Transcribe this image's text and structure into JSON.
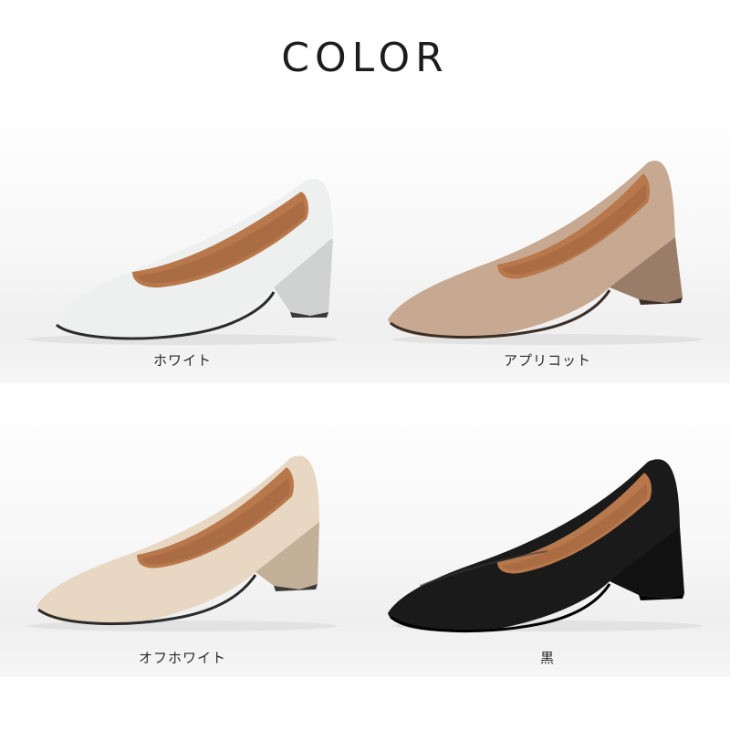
{
  "title": "COLOR",
  "variants": [
    {
      "label": "ホワイト",
      "color_outer": "#eef0ef",
      "color_shade": "#d9dbda",
      "color_heel": "#cfd2d1"
    },
    {
      "label": "アプリコット",
      "color_outer": "#c7a991",
      "color_shade": "#a98a74",
      "color_heel": "#9a7d69"
    },
    {
      "label": "オフホワイト",
      "color_outer": "#e8d8c3",
      "color_shade": "#d1bfa7",
      "color_heel": "#c3b098"
    },
    {
      "label": "黒",
      "color_outer": "#1a1a1a",
      "color_shade": "#0c0c0c",
      "color_heel": "#111111"
    }
  ],
  "lining_color": "#b9784c"
}
